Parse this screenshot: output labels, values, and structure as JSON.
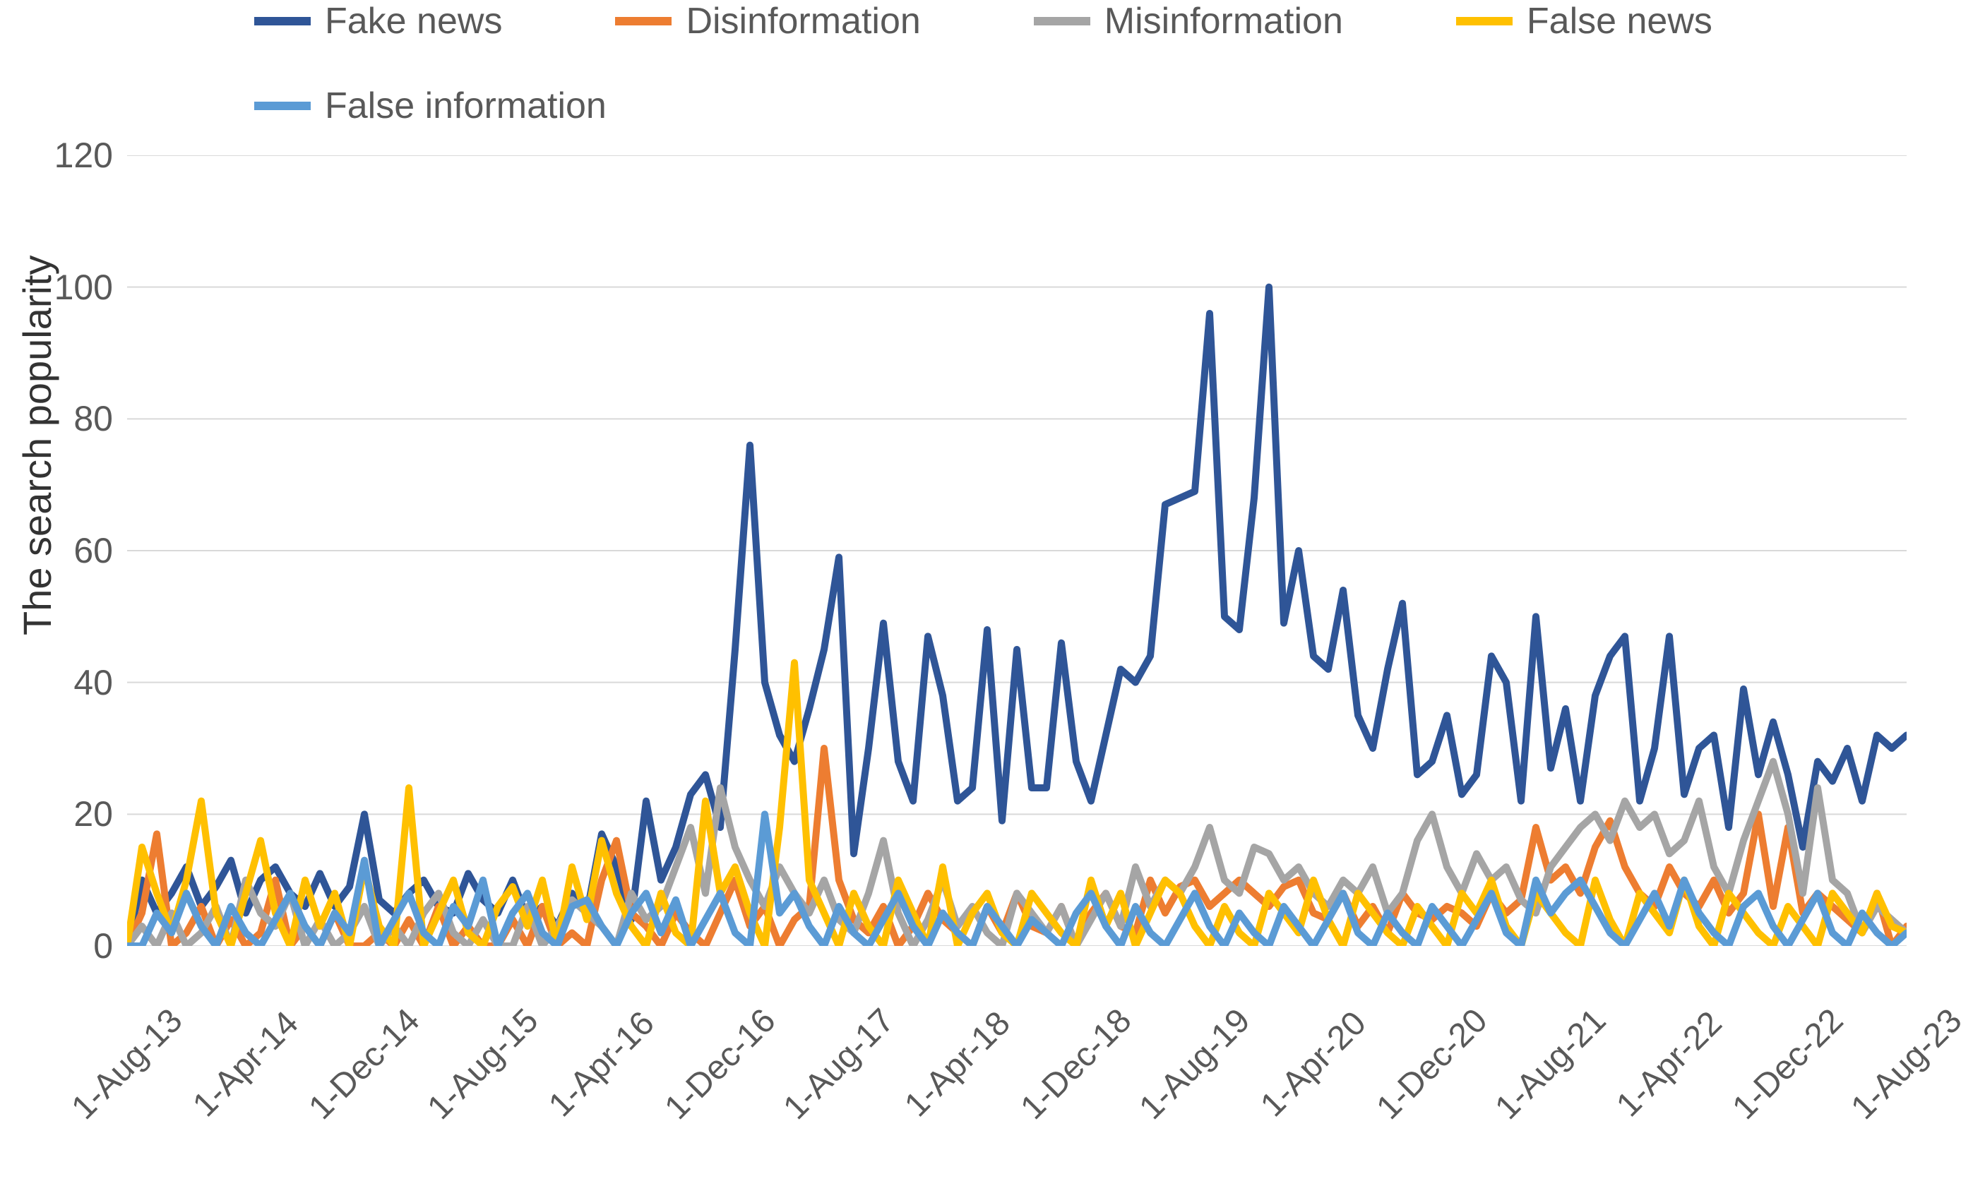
{
  "chart_data": {
    "type": "line",
    "title": "",
    "xlabel": "",
    "ylabel": "The search popularity",
    "ylim": [
      0,
      120
    ],
    "yticks": [
      0,
      20,
      40,
      60,
      80,
      100,
      120
    ],
    "colors": {
      "Fake news": "#2f5597",
      "Disinformation": "#ed7d31",
      "Misinformation": "#a5a5a5",
      "False news": "#ffc000",
      "False information": "#5b9bd5"
    },
    "x_tick_labels": [
      "1-Aug-13",
      "1-Apr-14",
      "1-Dec-14",
      "1-Aug-15",
      "1-Apr-16",
      "1-Dec-16",
      "1-Aug-17",
      "1-Apr-18",
      "1-Dec-18",
      "1-Aug-19",
      "1-Apr-20",
      "1-Dec-20",
      "1-Aug-21",
      "1-Apr-22",
      "1-Dec-22",
      "1-Aug-23"
    ],
    "x_tick_positions": [
      0,
      8,
      16,
      24,
      32,
      40,
      48,
      56,
      64,
      72,
      80,
      88,
      96,
      104,
      112,
      120
    ],
    "n_points": 121,
    "series": [
      {
        "name": "Fake news",
        "values": [
          0,
          10,
          5,
          8,
          12,
          6,
          9,
          13,
          5,
          10,
          12,
          8,
          6,
          11,
          6,
          9,
          20,
          7,
          5,
          8,
          10,
          6,
          5,
          11,
          7,
          5,
          10,
          4,
          6,
          3,
          8,
          5,
          17,
          12,
          4,
          22,
          10,
          15,
          23,
          26,
          18,
          45,
          76,
          40,
          32,
          28,
          36,
          45,
          59,
          14,
          30,
          49,
          28,
          22,
          47,
          38,
          22,
          24,
          48,
          19,
          45,
          24,
          24,
          46,
          28,
          22,
          32,
          42,
          40,
          44,
          67,
          68,
          69,
          96,
          50,
          48,
          68,
          100,
          49,
          60,
          44,
          42,
          54,
          35,
          30,
          42,
          52,
          26,
          28,
          35,
          23,
          26,
          44,
          40,
          22,
          50,
          27,
          36,
          22,
          38,
          44,
          47,
          22,
          30,
          47,
          23,
          30,
          32,
          18,
          39,
          26,
          34,
          26,
          15,
          28,
          25,
          30,
          22,
          32,
          30,
          32
        ]
      },
      {
        "name": "Disinformation",
        "values": [
          0,
          5,
          17,
          0,
          2,
          6,
          0,
          4,
          0,
          2,
          10,
          0,
          3,
          0,
          5,
          0,
          0,
          2,
          0,
          4,
          0,
          6,
          0,
          3,
          0,
          0,
          4,
          0,
          6,
          0,
          2,
          0,
          10,
          16,
          5,
          3,
          0,
          5,
          2,
          0,
          5,
          10,
          3,
          6,
          0,
          4,
          6,
          30,
          10,
          4,
          2,
          6,
          0,
          3,
          8,
          4,
          2,
          0,
          6,
          2,
          8,
          3,
          2,
          6,
          0,
          5,
          8,
          3,
          2,
          10,
          5,
          9,
          10,
          6,
          8,
          10,
          8,
          6,
          9,
          10,
          5,
          4,
          8,
          3,
          6,
          2,
          8,
          5,
          4,
          6,
          5,
          3,
          8,
          5,
          7,
          18,
          10,
          12,
          8,
          15,
          19,
          12,
          8,
          6,
          12,
          8,
          6,
          10,
          5,
          8,
          20,
          6,
          18,
          5,
          8,
          6,
          4,
          2,
          8,
          0,
          3
        ]
      },
      {
        "name": "Misinformation",
        "values": [
          0,
          3,
          0,
          5,
          0,
          2,
          6,
          0,
          10,
          5,
          3,
          8,
          0,
          4,
          0,
          2,
          6,
          0,
          3,
          0,
          5,
          8,
          2,
          0,
          4,
          0,
          0,
          6,
          0,
          3,
          7,
          5,
          3,
          0,
          8,
          4,
          6,
          12,
          18,
          8,
          24,
          15,
          10,
          6,
          12,
          8,
          5,
          10,
          4,
          2,
          8,
          16,
          5,
          0,
          4,
          10,
          3,
          6,
          2,
          0,
          8,
          5,
          2,
          6,
          0,
          4,
          8,
          3,
          12,
          6,
          10,
          8,
          12,
          18,
          10,
          8,
          15,
          14,
          10,
          12,
          8,
          6,
          10,
          8,
          12,
          5,
          8,
          16,
          20,
          12,
          8,
          14,
          10,
          12,
          7,
          5,
          12,
          15,
          18,
          20,
          16,
          22,
          18,
          20,
          14,
          16,
          22,
          12,
          8,
          16,
          22,
          28,
          20,
          8,
          24,
          10,
          8,
          2,
          6,
          4,
          2
        ]
      },
      {
        "name": "False news",
        "values": [
          0,
          15,
          8,
          2,
          10,
          22,
          5,
          0,
          8,
          16,
          5,
          0,
          10,
          3,
          8,
          0,
          12,
          3,
          0,
          24,
          0,
          5,
          10,
          2,
          0,
          6,
          9,
          3,
          10,
          0,
          12,
          4,
          16,
          8,
          3,
          0,
          8,
          2,
          0,
          22,
          8,
          12,
          5,
          0,
          18,
          43,
          10,
          5,
          0,
          8,
          3,
          0,
          10,
          5,
          0,
          12,
          0,
          5,
          8,
          2,
          0,
          8,
          5,
          2,
          0,
          10,
          3,
          8,
          0,
          5,
          10,
          8,
          3,
          0,
          6,
          2,
          0,
          8,
          5,
          2,
          10,
          4,
          0,
          8,
          5,
          2,
          0,
          6,
          3,
          0,
          8,
          5,
          10,
          3,
          0,
          8,
          5,
          2,
          0,
          10,
          4,
          0,
          8,
          5,
          2,
          10,
          3,
          0,
          8,
          5,
          2,
          0,
          6,
          3,
          0,
          8,
          5,
          2,
          8,
          3,
          2
        ]
      },
      {
        "name": "False information",
        "values": [
          0,
          0,
          5,
          2,
          8,
          3,
          0,
          6,
          2,
          0,
          4,
          8,
          3,
          0,
          5,
          2,
          13,
          0,
          4,
          8,
          2,
          0,
          6,
          3,
          10,
          0,
          5,
          8,
          2,
          0,
          6,
          7,
          3,
          0,
          5,
          8,
          2,
          7,
          0,
          4,
          8,
          2,
          0,
          20,
          5,
          8,
          3,
          0,
          6,
          2,
          0,
          4,
          8,
          3,
          0,
          5,
          2,
          0,
          6,
          3,
          0,
          4,
          2,
          0,
          5,
          8,
          3,
          0,
          6,
          2,
          0,
          4,
          8,
          3,
          0,
          5,
          2,
          0,
          6,
          3,
          0,
          4,
          8,
          2,
          0,
          5,
          2,
          0,
          6,
          3,
          0,
          4,
          8,
          2,
          0,
          10,
          5,
          8,
          10,
          6,
          2,
          0,
          4,
          8,
          3,
          10,
          5,
          2,
          0,
          6,
          8,
          3,
          0,
          4,
          8,
          2,
          0,
          5,
          2,
          0,
          2
        ]
      }
    ]
  }
}
